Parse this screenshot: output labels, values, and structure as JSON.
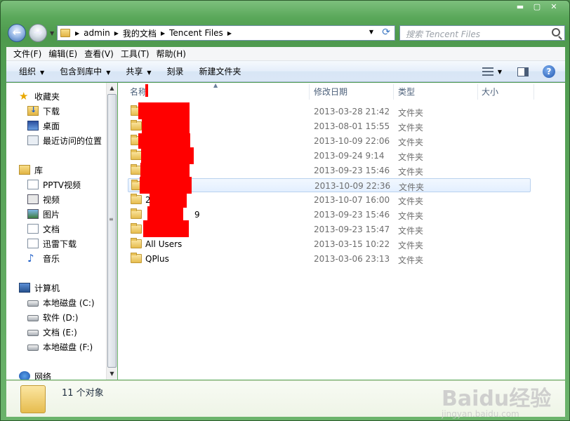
{
  "window": {
    "controls": {
      "minimize": "▬",
      "maximize": "▢",
      "close": "✕"
    }
  },
  "nav": {
    "back_glyph": "←",
    "forward_glyph": "→",
    "breadcrumbs": [
      "admin",
      "我的文档",
      "Tencent Files"
    ],
    "search_placeholder": "搜索 Tencent Files"
  },
  "menubar": [
    "文件(F)",
    "编辑(E)",
    "查看(V)",
    "工具(T)",
    "帮助(H)"
  ],
  "commandbar": {
    "organize": "组织",
    "include_library": "包含到库中",
    "share": "共享",
    "burn": "刻录",
    "new_folder": "新建文件夹",
    "help": "?"
  },
  "sidebar": {
    "favorites": {
      "header": "收藏夹",
      "items": [
        "下载",
        "桌面",
        "最近访问的位置"
      ]
    },
    "libraries": {
      "header": "库",
      "items": [
        "PPTV视频",
        "视频",
        "图片",
        "文档",
        "迅雷下载",
        "音乐"
      ]
    },
    "computer": {
      "header": "计算机",
      "items": [
        "本地磁盘 (C:)",
        "软件 (D:)",
        "文档 (E:)",
        "本地磁盘 (F:)"
      ]
    },
    "network": {
      "header": "网络"
    }
  },
  "columns": {
    "name": "名称",
    "date": "修改日期",
    "type": "类型",
    "size": "大小"
  },
  "files": [
    {
      "name": "",
      "date": "2013-03-28 21:42",
      "type": "文件夹"
    },
    {
      "name": "",
      "date": "2013-08-01 15:55",
      "type": "文件夹"
    },
    {
      "name": "",
      "date": "2013-10-09 22:06",
      "type": "文件夹"
    },
    {
      "name": "",
      "date": "2013-09-24 9:14",
      "type": "文件夹"
    },
    {
      "name": "",
      "date": "2013-09-23 15:46",
      "type": "文件夹"
    },
    {
      "name": "",
      "date": "2013-10-09 22:36",
      "type": "文件夹",
      "selected": true
    },
    {
      "name": "2",
      "date": "2013-10-07 16:00",
      "type": "文件夹"
    },
    {
      "name": "9",
      "date": "2013-09-23 15:46",
      "type": "文件夹"
    },
    {
      "name": "",
      "date": "2013-09-23 15:47",
      "type": "文件夹"
    },
    {
      "name": "All Users",
      "date": "2013-03-15 10:22",
      "type": "文件夹"
    },
    {
      "name": "QPlus",
      "date": "2013-03-06 23:13",
      "type": "文件夹"
    }
  ],
  "status": {
    "count_text": "11 个对象"
  },
  "watermark": {
    "main": "Baidu经验",
    "sub": "jingyan.baidu.com"
  }
}
